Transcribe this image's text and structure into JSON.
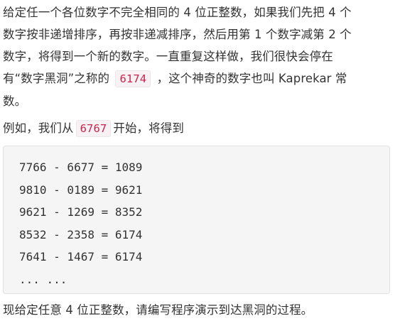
{
  "paragraph1": {
    "line1": "给定任一个各位数字不完全相同的 4 位正整数，如果我们先把 4 个",
    "line2": "数字按非递增排序，再按非递减排序，然后用第 1 个数字减第 2 个",
    "line3": "数字，将得到一个新的数字。一直重复这样做，我们很快会停在",
    "line4_before": "有“数字黑洞”之称的",
    "constant": "6174",
    "line4_after": "，这个神奇的数字也叫 Kaprekar 常",
    "line5": "数。"
  },
  "paragraph2": {
    "before": "例如，我们从",
    "start_number": "6767",
    "after": "开始，将得到"
  },
  "code_block": {
    "lines": [
      "7766 - 6677 = 1089",
      "9810 - 0189 = 9621",
      "9621 - 1269 = 8352",
      "8532 - 2358 = 6174",
      "7641 - 1467 = 6174",
      "... ..."
    ]
  },
  "paragraph3": {
    "text": "现给定任意 4 位正整数，请编写程序演示到达黑洞的过程。"
  }
}
